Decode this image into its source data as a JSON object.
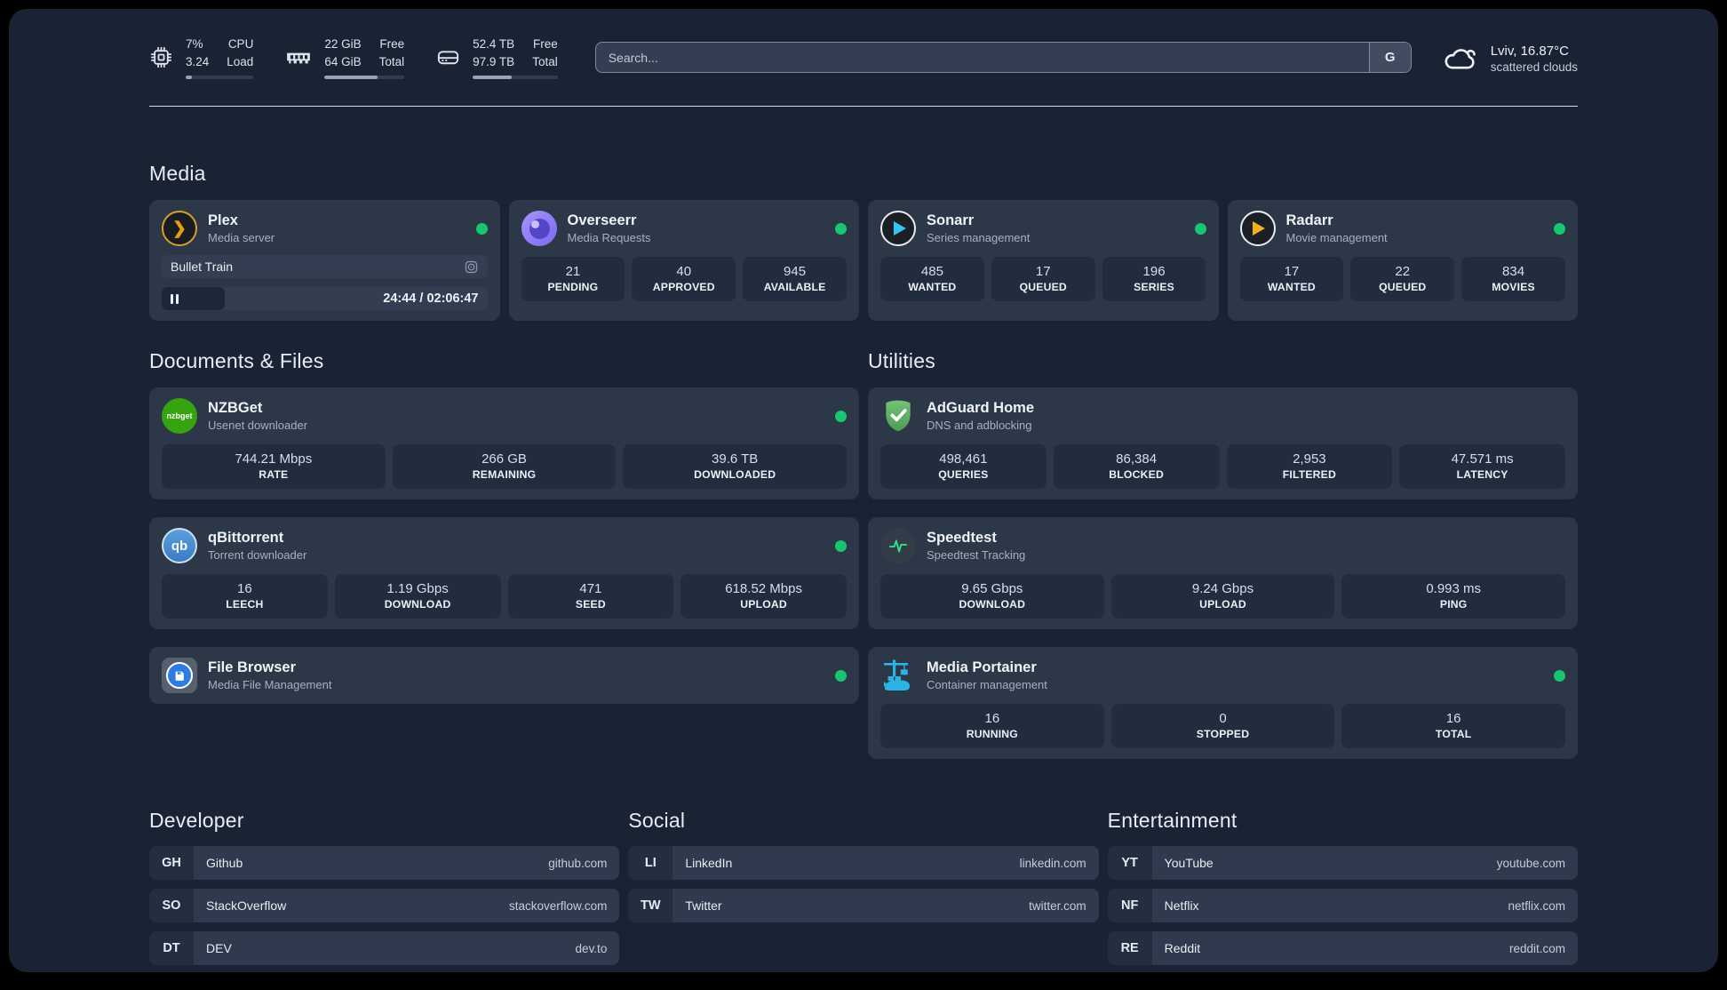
{
  "header": {
    "stats": [
      {
        "id": "cpu",
        "line1": "7%",
        "line2": "3.24",
        "label1": "CPU",
        "label2": "Load",
        "progress_style": "width:9%"
      },
      {
        "id": "ram",
        "line1": "22 GiB",
        "line2": "64 GiB",
        "label1": "Free",
        "label2": "Total",
        "progress_style": "width:66%"
      },
      {
        "id": "disk",
        "line1": "52.4 TB",
        "line2": "97.9 TB",
        "label1": "Free",
        "label2": "Total",
        "progress_style": "width:46%"
      }
    ],
    "search": {
      "placeholder": "Search...",
      "button_label": "G"
    },
    "weather": {
      "location": "Lviv, 16.87°C",
      "condition": "scattered clouds"
    }
  },
  "media": {
    "title": "Media",
    "plex": {
      "name": "Plex",
      "subtitle": "Media server",
      "status": "online",
      "now_playing": {
        "title": "Bullet Train",
        "time_display": "24:44 / 02:06:47",
        "progress_style": "width:19.5%"
      }
    },
    "overseerr": {
      "name": "Overseerr",
      "subtitle": "Media Requests",
      "status": "online",
      "stats": [
        {
          "value": "21",
          "label": "PENDING"
        },
        {
          "value": "40",
          "label": "APPROVED"
        },
        {
          "value": "945",
          "label": "AVAILABLE"
        }
      ]
    },
    "sonarr": {
      "name": "Sonarr",
      "subtitle": "Series management",
      "status": "online",
      "stats": [
        {
          "value": "485",
          "label": "WANTED"
        },
        {
          "value": "17",
          "label": "QUEUED"
        },
        {
          "value": "196",
          "label": "SERIES"
        }
      ]
    },
    "radarr": {
      "name": "Radarr",
      "subtitle": "Movie management",
      "status": "online",
      "stats": [
        {
          "value": "17",
          "label": "WANTED"
        },
        {
          "value": "22",
          "label": "QUEUED"
        },
        {
          "value": "834",
          "label": "MOVIES"
        }
      ]
    }
  },
  "documents": {
    "title": "Documents & Files",
    "nzbget": {
      "name": "NZBGet",
      "subtitle": "Usenet downloader",
      "status": "online",
      "icon_text": "nzbget",
      "stats": [
        {
          "value": "744.21 Mbps",
          "label": "RATE"
        },
        {
          "value": "266 GB",
          "label": "REMAINING"
        },
        {
          "value": "39.6 TB",
          "label": "DOWNLOADED"
        }
      ]
    },
    "qbittorrent": {
      "name": "qBittorrent",
      "subtitle": "Torrent downloader",
      "status": "online",
      "icon_text": "qb",
      "stats": [
        {
          "value": "16",
          "label": "LEECH"
        },
        {
          "value": "1.19 Gbps",
          "label": "DOWNLOAD"
        },
        {
          "value": "471",
          "label": "SEED"
        },
        {
          "value": "618.52 Mbps",
          "label": "UPLOAD"
        }
      ]
    },
    "filebrowser": {
      "name": "File Browser",
      "subtitle": "Media File Management",
      "status": "online"
    }
  },
  "utilities": {
    "title": "Utilities",
    "adguard": {
      "name": "AdGuard Home",
      "subtitle": "DNS and adblocking",
      "stats": [
        {
          "value": "498,461",
          "label": "QUERIES"
        },
        {
          "value": "86,384",
          "label": "BLOCKED"
        },
        {
          "value": "2,953",
          "label": "FILTERED"
        },
        {
          "value": "47.571 ms",
          "label": "LATENCY"
        }
      ]
    },
    "speedtest": {
      "name": "Speedtest",
      "subtitle": "Speedtest Tracking",
      "stats": [
        {
          "value": "9.65 Gbps",
          "label": "DOWNLOAD"
        },
        {
          "value": "9.24 Gbps",
          "label": "UPLOAD"
        },
        {
          "value": "0.993 ms",
          "label": "PING"
        }
      ]
    },
    "portainer": {
      "name": "Media Portainer",
      "subtitle": "Container management",
      "status": "online",
      "stats": [
        {
          "value": "16",
          "label": "RUNNING"
        },
        {
          "value": "0",
          "label": "STOPPED"
        },
        {
          "value": "16",
          "label": "TOTAL"
        }
      ]
    }
  },
  "bookmarks": [
    {
      "title": "Developer",
      "links": [
        {
          "abbr": "GH",
          "name": "Github",
          "url": "github.com"
        },
        {
          "abbr": "SO",
          "name": "StackOverflow",
          "url": "stackoverflow.com"
        },
        {
          "abbr": "DT",
          "name": "DEV",
          "url": "dev.to"
        }
      ]
    },
    {
      "title": "Social",
      "links": [
        {
          "abbr": "LI",
          "name": "LinkedIn",
          "url": "linkedin.com"
        },
        {
          "abbr": "TW",
          "name": "Twitter",
          "url": "twitter.com"
        }
      ]
    },
    {
      "title": "Entertainment",
      "links": [
        {
          "abbr": "YT",
          "name": "YouTube",
          "url": "youtube.com"
        },
        {
          "abbr": "NF",
          "name": "Netflix",
          "url": "netflix.com"
        },
        {
          "abbr": "RE",
          "name": "Reddit",
          "url": "reddit.com"
        }
      ]
    }
  ],
  "colors": {
    "status_online": "#18c671",
    "plex_accent": "#e5a00d",
    "sonarr_accent": "#35c5f4",
    "radarr_accent": "#f5b01f",
    "nzbget_accent": "#36a410",
    "adguard_accent": "#5aa35f",
    "qbittorrent_accent": "#4a90d9",
    "portainer_accent": "#2bb3e6",
    "speedtest_accent": "#2ee08c"
  }
}
